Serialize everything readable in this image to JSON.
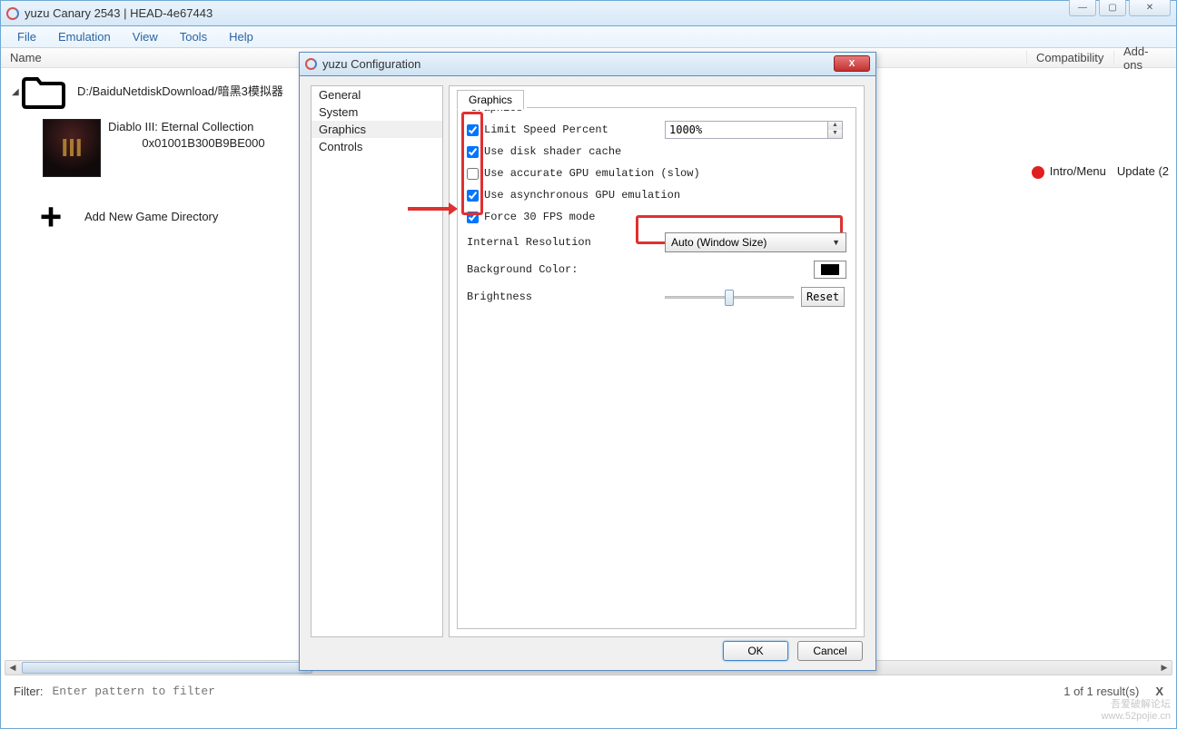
{
  "main_window": {
    "title": "yuzu Canary 2543 | HEAD-4e67443",
    "menu": [
      "File",
      "Emulation",
      "View",
      "Tools",
      "Help"
    ],
    "columns": {
      "name": "Name",
      "compat": "Compatibility",
      "addons": "Add-ons"
    },
    "folder_path": "D:/BaiduNetdiskDownload/暗黑3模拟器",
    "game": {
      "title": "Diablo III: Eternal Collection",
      "id": "0x01001B300B9BE000",
      "status": "Intro/Menu",
      "addon": "Update (2"
    },
    "add_dir": "Add New Game Directory",
    "filter_label": "Filter:",
    "filter_placeholder": "Enter pattern to filter",
    "results": "1 of 1 result(s)",
    "results_x": "X"
  },
  "dialog": {
    "title": "yuzu Configuration",
    "nav": [
      "General",
      "System",
      "Graphics",
      "Controls"
    ],
    "tab": "Graphics",
    "group": "Graphics",
    "checks": {
      "limit_speed": "Limit Speed Percent",
      "disk_shader": "Use disk shader cache",
      "accurate_gpu": "Use accurate GPU emulation (slow)",
      "async_gpu": "Use asynchronous GPU emulation",
      "force_30fps": "Force 30 FPS mode"
    },
    "speed_value": "1000%",
    "internal_res_label": "Internal Resolution",
    "internal_res_value": "Auto (Window Size)",
    "bg_color_label": "Background Color:",
    "brightness_label": "Brightness",
    "reset": "Reset",
    "ok": "OK",
    "cancel": "Cancel"
  },
  "watermark": {
    "line1": "吾爱破解论坛",
    "line2": "www.52pojie.cn"
  }
}
